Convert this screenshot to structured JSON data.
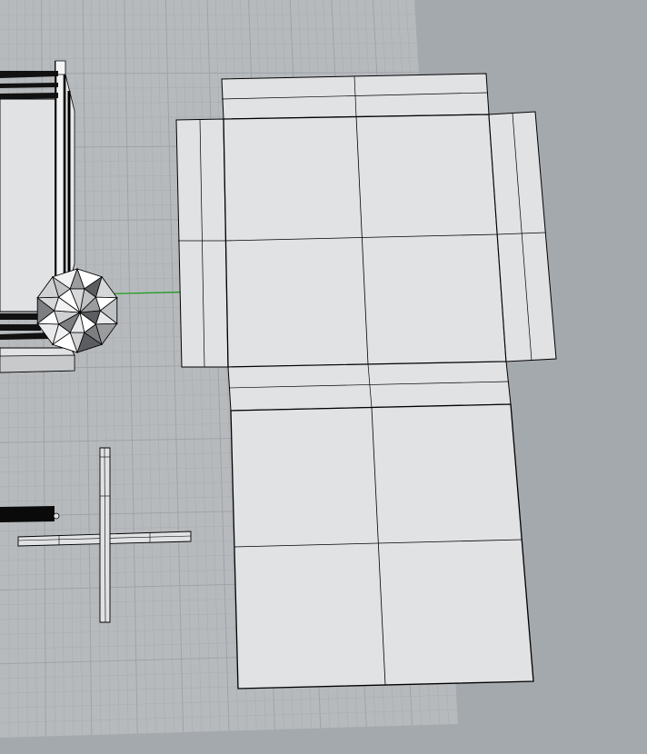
{
  "viewport": {
    "view": "perspective",
    "background_color": "#a4a9ae",
    "construction_plane_color": "#b7babd",
    "grid_minor_line_color": "#a9adb1",
    "grid_major_line_color": "#9ea3a8",
    "x_axis_color": "#000000",
    "y_axis_color": "#1ba01b",
    "wireframe_edge_color": "#000000",
    "shaded_surface_color": "#e1e2e4"
  },
  "objects": [
    {
      "kind": "box-net-unfolded",
      "faces": 6,
      "state": "unselected"
    },
    {
      "kind": "geodesic-sphere",
      "state": "unselected"
    },
    {
      "kind": "box-frame",
      "state": "unselected"
    },
    {
      "kind": "cross-shape",
      "state": "unselected"
    },
    {
      "kind": "dark-bar",
      "state": "unselected"
    }
  ]
}
